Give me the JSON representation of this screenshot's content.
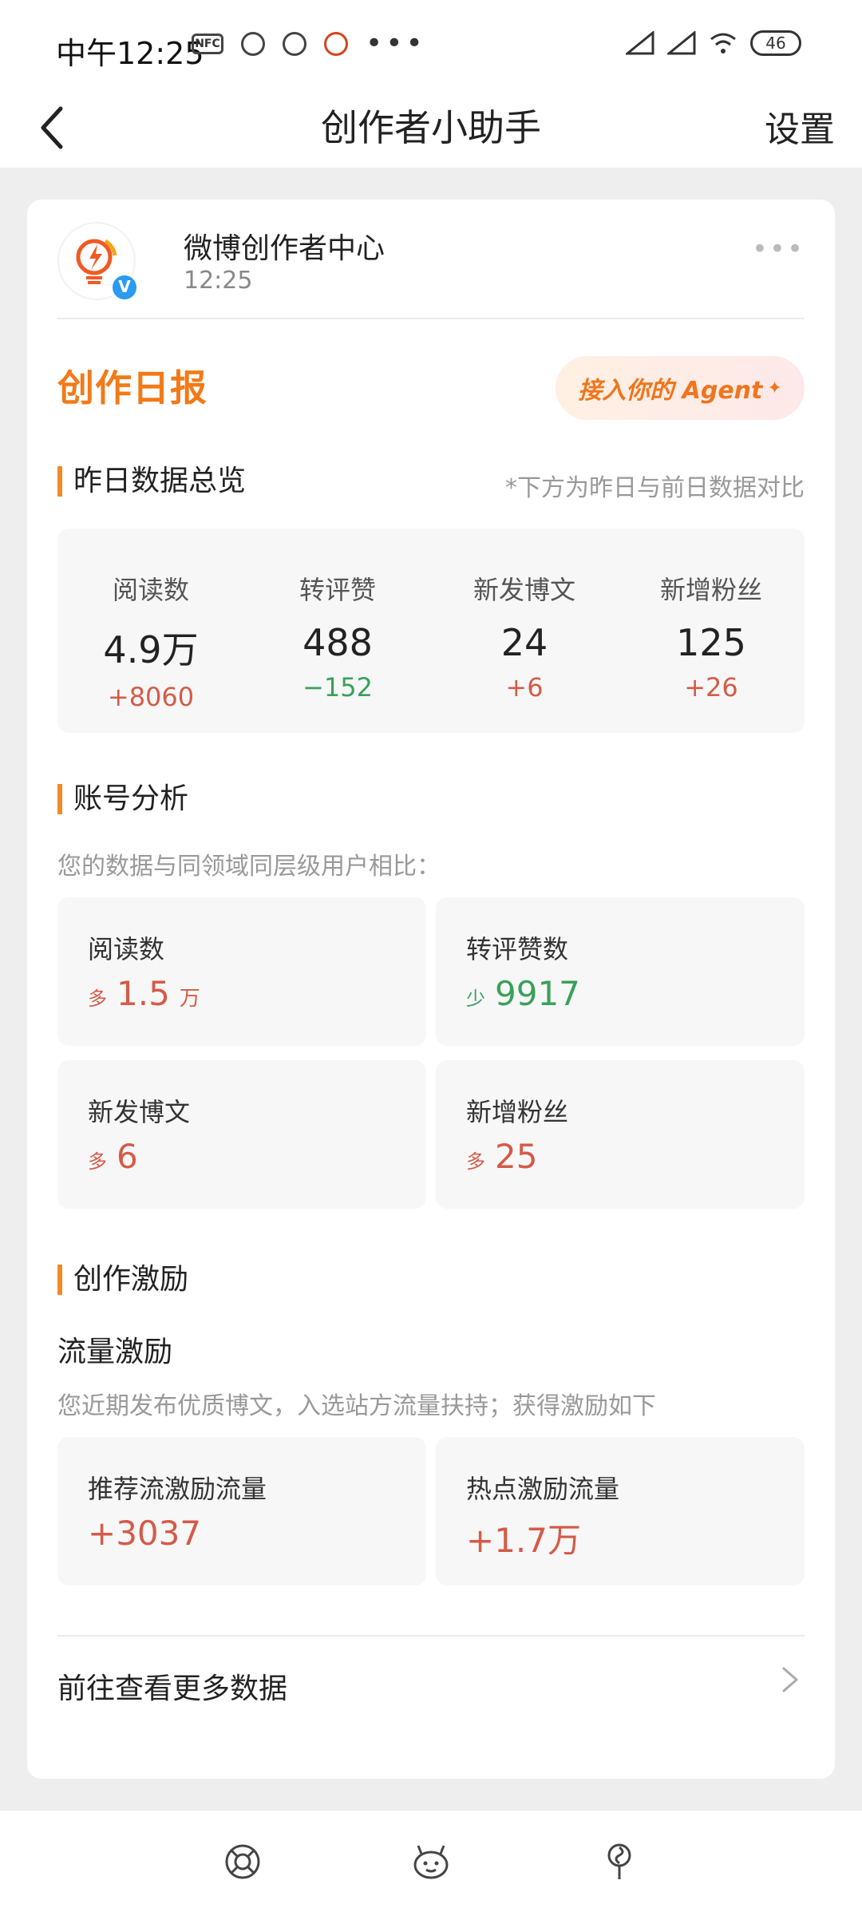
{
  "status_bar": {
    "time": "中午12:25",
    "nfc_label": "NFC",
    "more_dots": "•••",
    "battery": "46"
  },
  "header": {
    "title": "创作者小助手",
    "action": "设置"
  },
  "message": {
    "sender": "微博创作者中心",
    "time": "12:25",
    "more": "•••",
    "verify_mark": "V"
  },
  "report": {
    "title": "创作日报",
    "agent_button": "接入你的 Agent"
  },
  "overview": {
    "title": "昨日数据总览",
    "note": "*下方为昨日与前日数据对比",
    "items": [
      {
        "label": "阅读数",
        "value": "4.9万",
        "delta": "+8060"
      },
      {
        "label": "转评赞",
        "value": "488",
        "delta": "−152"
      },
      {
        "label": "新发博文",
        "value": "24",
        "delta": "+6"
      },
      {
        "label": "新增粉丝",
        "value": "125",
        "delta": "+26"
      }
    ]
  },
  "account_analysis": {
    "title": "账号分析",
    "note": "您的数据与同领域同层级用户相比：",
    "items": [
      {
        "label": "阅读数",
        "tag": "多",
        "value": "1.5",
        "unit": "万"
      },
      {
        "label": "转评赞数",
        "tag": "少",
        "value": "9917",
        "unit": ""
      },
      {
        "label": "新发博文",
        "tag": "多",
        "value": "6",
        "unit": ""
      },
      {
        "label": "新增粉丝",
        "tag": "多",
        "value": "25",
        "unit": ""
      }
    ]
  },
  "incentive": {
    "title": "创作激励",
    "subtitle": "流量激励",
    "note": "您近期发布优质博文，入选站方流量扶持；获得激励如下",
    "items": [
      {
        "label": "推荐流激励流量",
        "value": "+3037"
      },
      {
        "label": "热点激励流量",
        "value": "+1.7万"
      }
    ]
  },
  "footer_link": "前往查看更多数据",
  "colors": {
    "accent": "#f27a18",
    "increase": "#d45b47",
    "decrease": "#3aa05a",
    "verify": "#2a9bf0"
  }
}
